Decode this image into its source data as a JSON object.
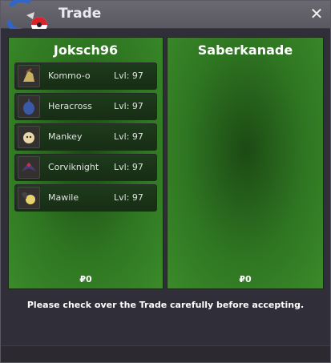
{
  "window": {
    "title": "Trade",
    "close_symbol": "✕"
  },
  "trade": {
    "left": {
      "player": "Joksch96",
      "money": "₽0",
      "pokemon": [
        {
          "name": "Kommo-o",
          "level": "Lvl: 97",
          "icon": "kommo-o-icon"
        },
        {
          "name": "Heracross",
          "level": "Lvl: 97",
          "icon": "heracross-icon"
        },
        {
          "name": "Mankey",
          "level": "Lvl: 97",
          "icon": "mankey-icon"
        },
        {
          "name": "Corviknight",
          "level": "Lvl: 97",
          "icon": "corviknight-icon"
        },
        {
          "name": "Mawile",
          "level": "Lvl: 97",
          "icon": "mawile-icon"
        }
      ]
    },
    "right": {
      "player": "Saberkanade",
      "money": "₽0",
      "pokemon": []
    },
    "message": "Please check over the Trade carefully before accepting."
  },
  "colors": {
    "panel_green": "#2f7622",
    "title_bg": "#5f5d66",
    "window_bg": "#302e38"
  }
}
